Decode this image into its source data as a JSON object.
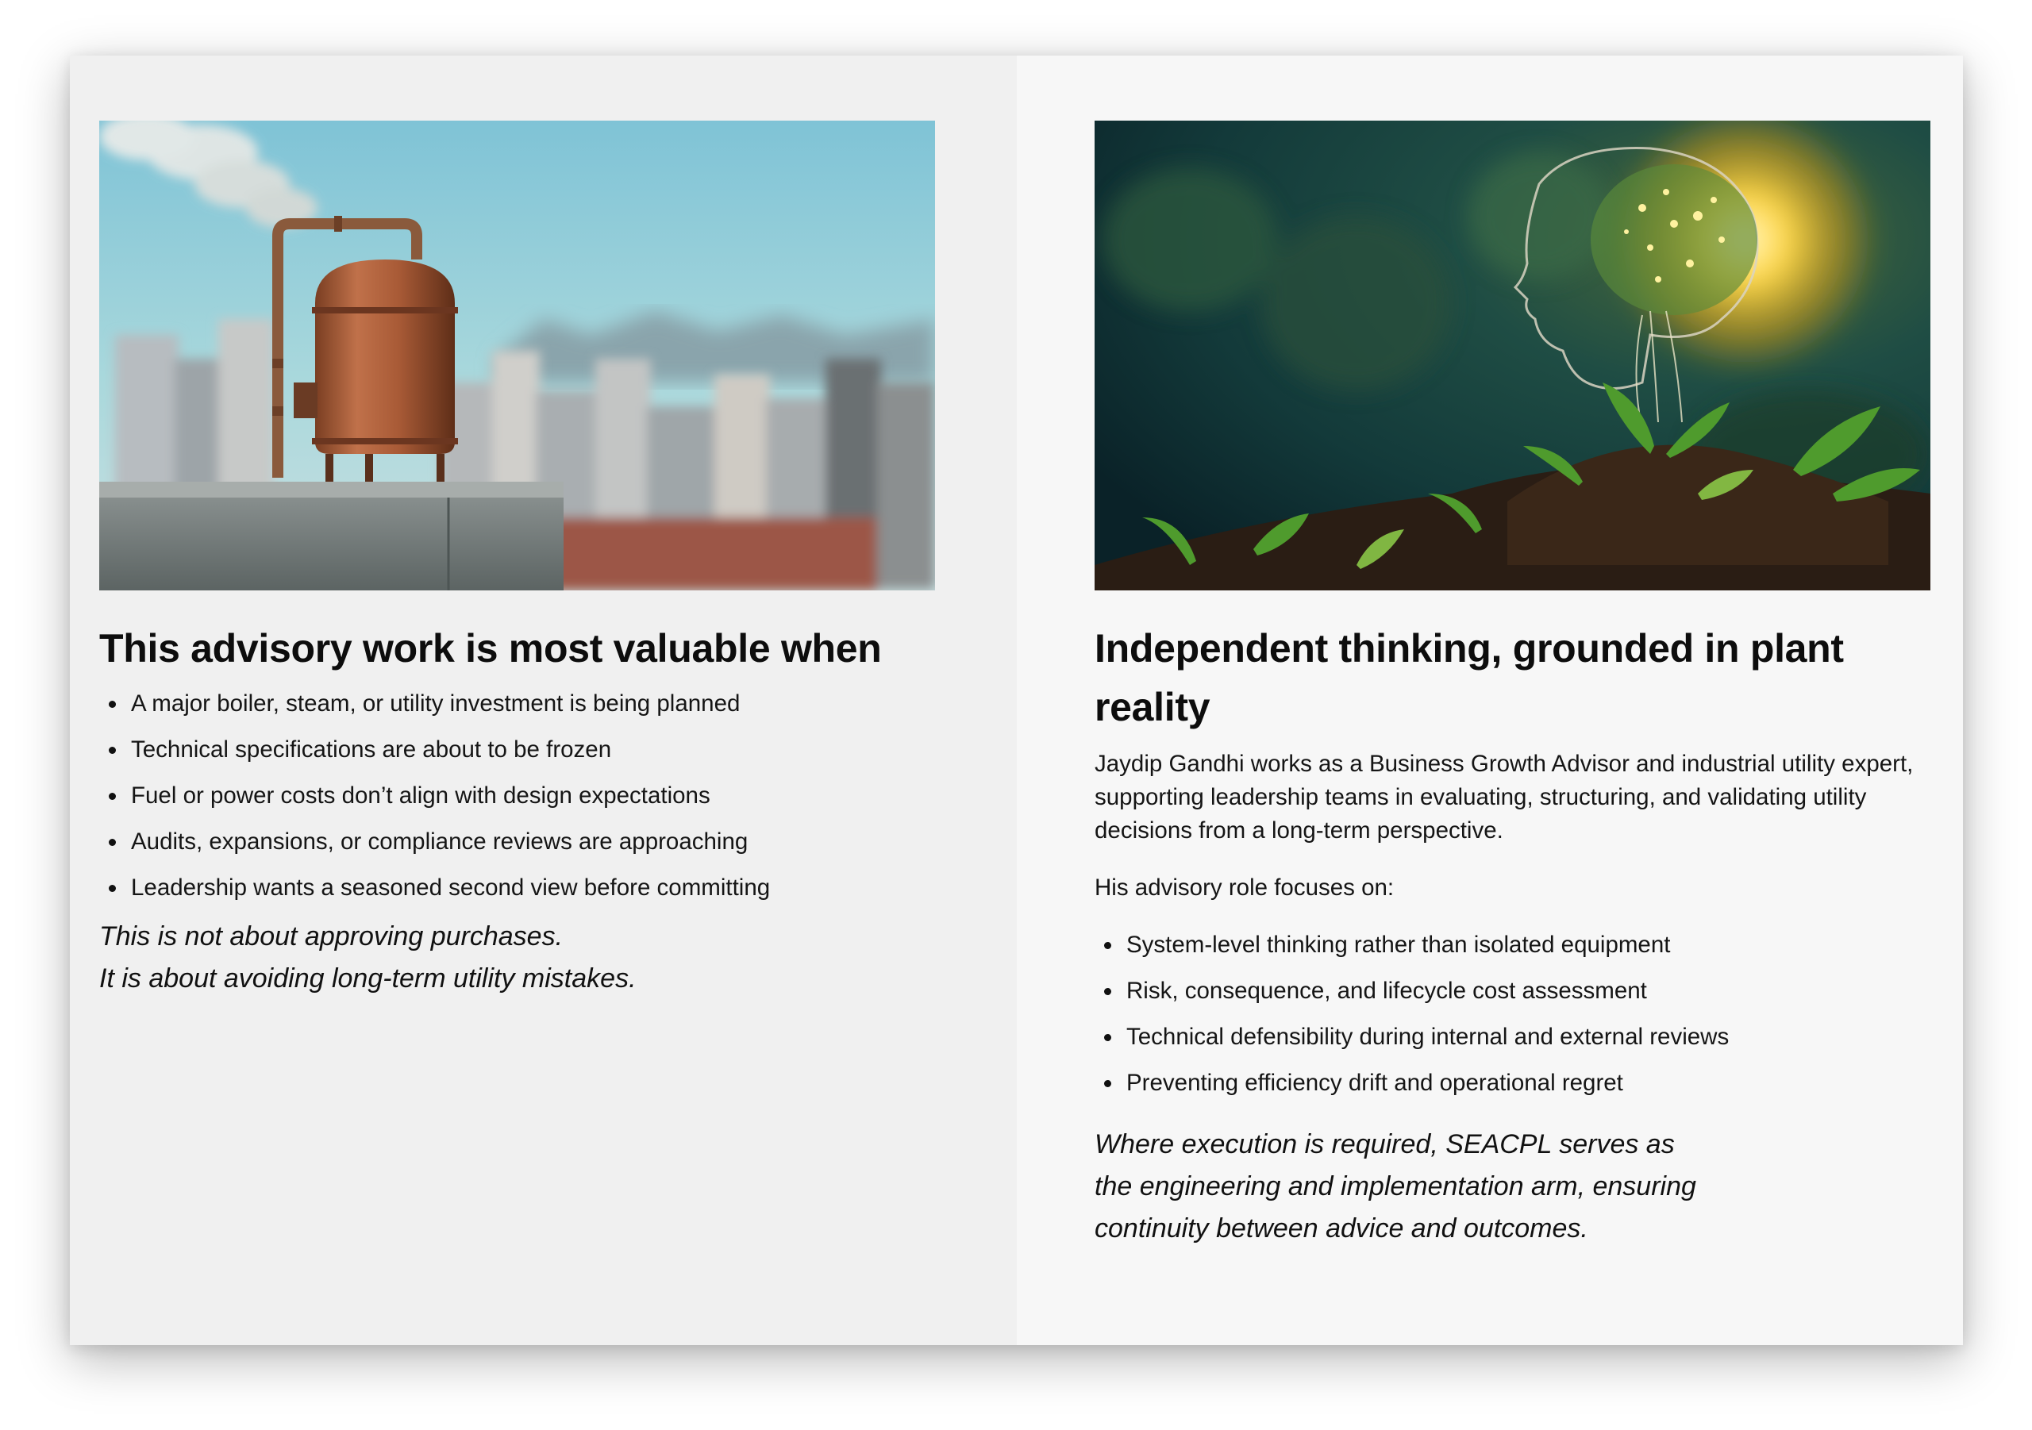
{
  "left": {
    "image_alt": "copper boiler tank with pipe on rooftop over city",
    "heading": "This advisory work is most valuable when",
    "bullets": [
      "A major boiler, steam, or utility investment is being planned",
      "Technical specifications are about to be frozen",
      "Fuel or power costs don’t align with design expectations",
      "Audits, expansions, or compliance reviews are approaching",
      "Leadership wants a seasoned second view before committing"
    ],
    "note_line1": "This is not about approving purchases.",
    "note_line2": "It is about avoiding long-term utility mistakes."
  },
  "right": {
    "image_alt": "glowing head outline with brain and plants growing from soil",
    "heading": "Independent thinking, grounded in plant reality",
    "bio": "Jaydip Gandhi works as a Business Growth Advisor and industrial utility expert, supporting leadership teams in evaluating, structuring, and validating utility decisions from a long-term perspective.",
    "role_label": "His advisory role focuses on:",
    "bullets": [
      "System-level thinking rather than isolated equipment",
      "Risk, consequence, and lifecycle cost assessment",
      "Technical defensibility during internal and external reviews",
      "Preventing efficiency drift and operational regret"
    ],
    "closing": "Where execution is required, SEACPL serves as the engineering and implementation arm, ensuring continuity between advice and outcomes."
  },
  "colors": {
    "left_panel_bg": "#f0f0f0",
    "right_panel_bg": "#f7f7f7",
    "text": "#111111"
  }
}
